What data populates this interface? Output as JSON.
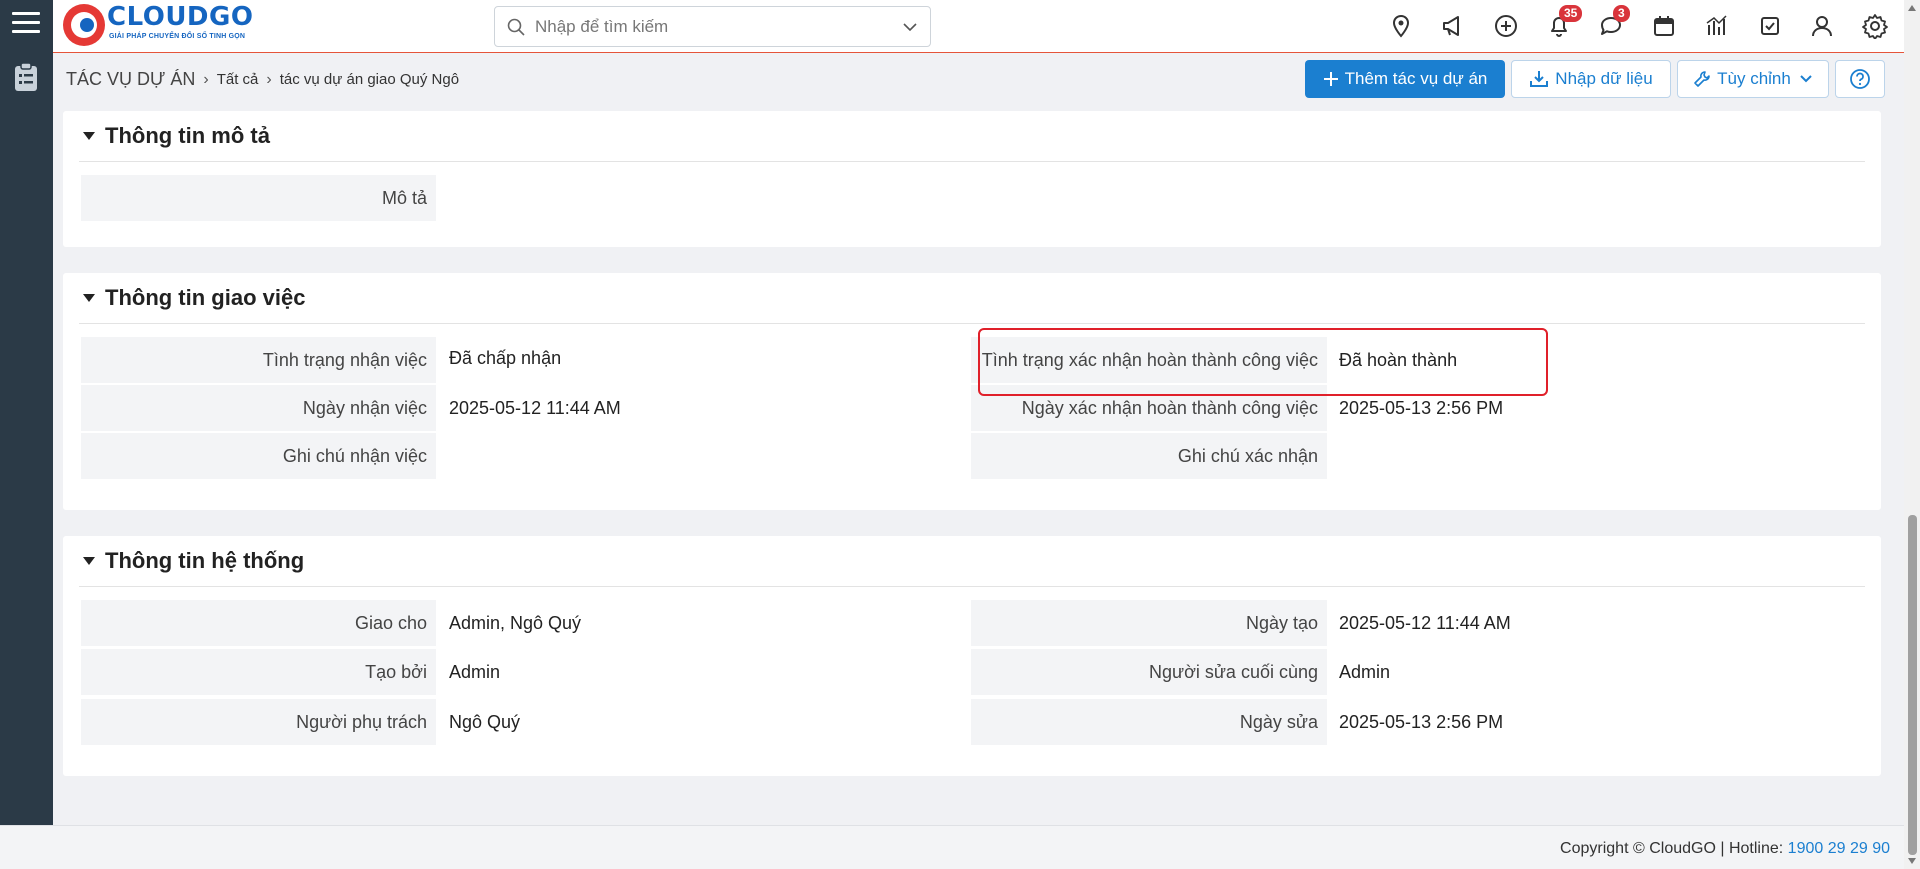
{
  "app": {
    "logo_name": "CLOUDGO",
    "logo_tagline": "GIẢI PHÁP CHUYỂN ĐỔI SỐ TINH GỌN"
  },
  "search": {
    "placeholder": "Nhập để tìm kiếm"
  },
  "header_icons": {
    "notifications_count": "35",
    "messages_count": "3"
  },
  "breadcrumb": {
    "module": "TÁC VỤ DỰ ÁN",
    "level1": "Tất cả",
    "level2": "tác vụ dự án giao Quý Ngô"
  },
  "toolbar": {
    "add_label": "Thêm tác vụ dự án",
    "import_label": "Nhập dữ liệu",
    "customize_label": "Tùy chỉnh"
  },
  "sections": {
    "description": {
      "title": "Thông tin mô tả",
      "fields": {
        "mo_ta": {
          "label": "Mô tả",
          "value": ""
        }
      }
    },
    "assignment": {
      "title": "Thông tin giao việc",
      "fields": {
        "tinh_trang_nhan_viec": {
          "label": "Tình trạng nhận việc",
          "value": "Đã chấp nhận"
        },
        "ngay_nhan_viec": {
          "label": "Ngày nhận việc",
          "value": "2025-05-12 11:44 AM"
        },
        "ghi_chu_nhan_viec": {
          "label": "Ghi chú nhận việc",
          "value": ""
        },
        "tinh_trang_xac_nhan": {
          "label": "Tình trạng xác nhận hoàn thành công việc",
          "value": "Đã hoàn thành"
        },
        "ngay_xac_nhan": {
          "label": "Ngày xác nhận hoàn thành công việc",
          "value": "2025-05-13 2:56 PM"
        },
        "ghi_chu_xac_nhan": {
          "label": "Ghi chú xác nhận",
          "value": ""
        }
      }
    },
    "system": {
      "title": "Thông tin hệ thống",
      "fields": {
        "giao_cho": {
          "label": "Giao cho",
          "value": "Admin, Ngô Quý"
        },
        "tao_boi": {
          "label": "Tạo bởi",
          "value": "Admin"
        },
        "nguoi_phu_trach": {
          "label": "Người phụ trách",
          "value": "Ngô Quý"
        },
        "ngay_tao": {
          "label": "Ngày tạo",
          "value": "2025-05-12 11:44 AM"
        },
        "nguoi_sua_cuoi": {
          "label": "Người sửa cuối cùng",
          "value": "Admin"
        },
        "ngay_sua": {
          "label": "Ngày sửa",
          "value": "2025-05-13 2:56 PM"
        }
      }
    }
  },
  "footer": {
    "copyright": "Copyright © CloudGO",
    "hotline_label": "Hotline:",
    "hotline_number": "1900 29 29 90"
  },
  "colors": {
    "primary": "#1b7fd0",
    "sidebar": "#2b3a47",
    "header_border": "#e5553a",
    "highlight": "#e0202a",
    "badge": "#d9343b"
  }
}
